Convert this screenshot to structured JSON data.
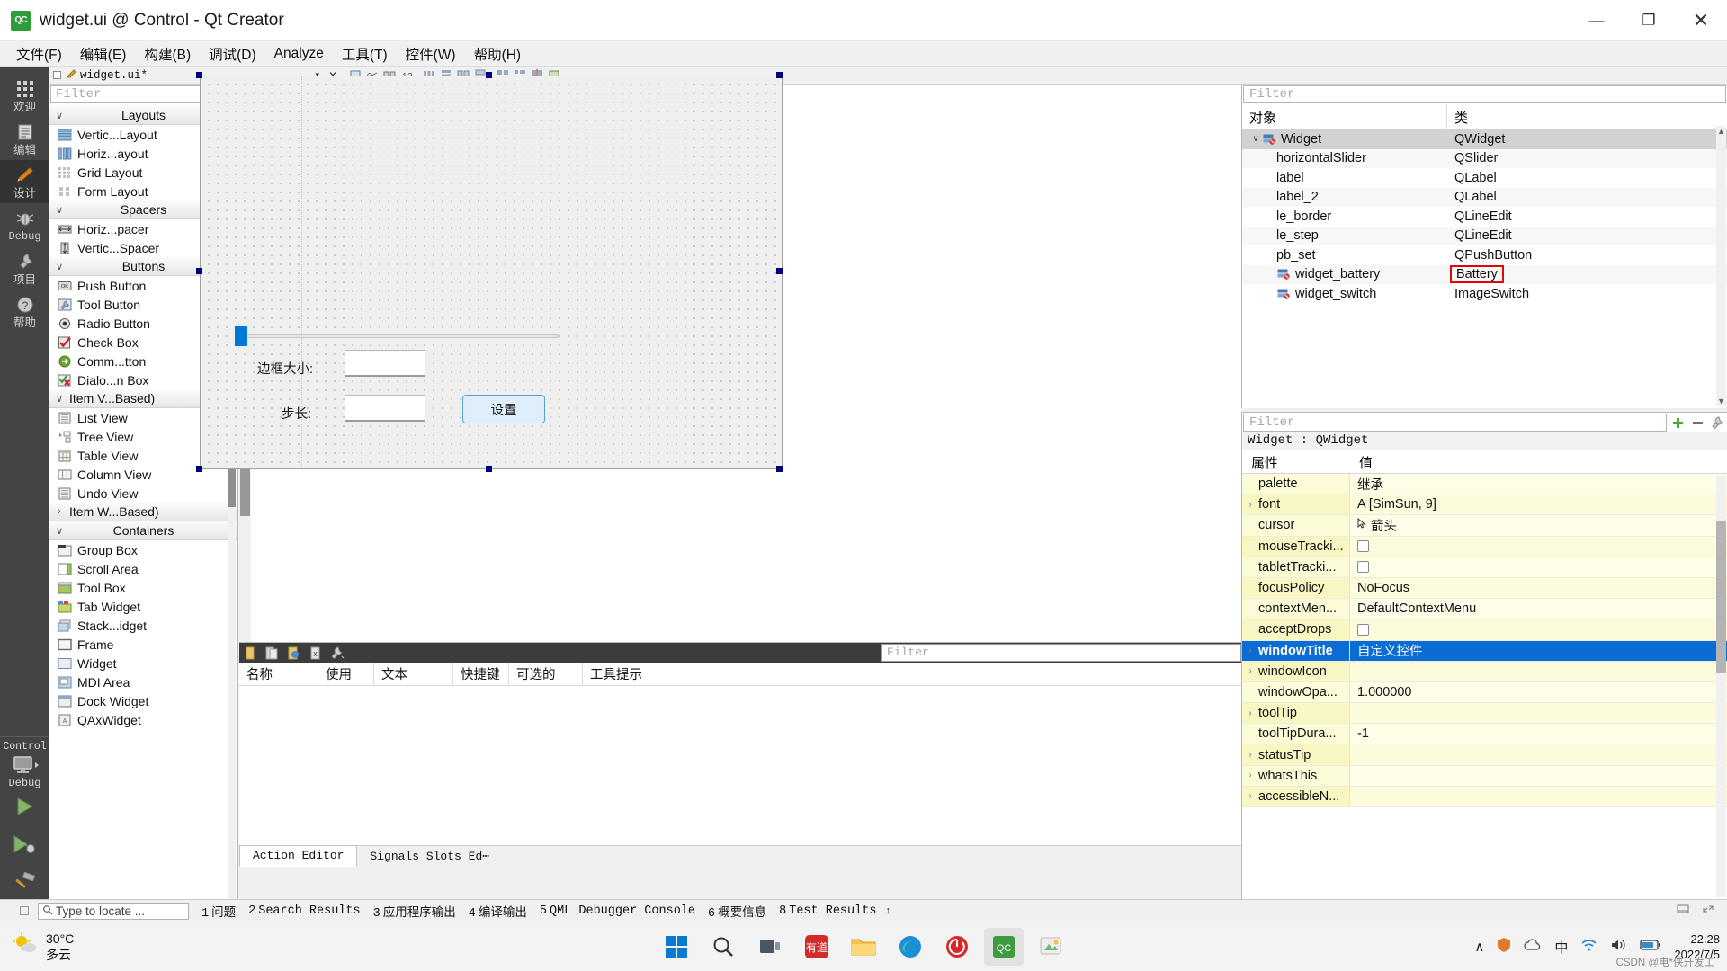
{
  "window": {
    "icon_label": "QC",
    "title": "widget.ui @ Control - Qt Creator",
    "minimize": "—",
    "maximize": "❐",
    "close": "✕"
  },
  "menubar": {
    "items": [
      "文件(F)",
      "编辑(E)",
      "构建(B)",
      "调试(D)",
      "Analyze",
      "工具(T)",
      "控件(W)",
      "帮助(H)"
    ]
  },
  "modebar": {
    "items": [
      {
        "label": "欢迎",
        "icon": "grid-icon"
      },
      {
        "label": "编辑",
        "icon": "document-icon"
      },
      {
        "label": "设计",
        "icon": "pencil-icon"
      },
      {
        "label": "Debug",
        "icon": "bug-icon"
      },
      {
        "label": "项目",
        "icon": "wrench-icon"
      },
      {
        "label": "帮助",
        "icon": "question-icon"
      }
    ],
    "active_index": 2,
    "kit_name": "Control",
    "kit_config": "Debug",
    "run_label": "run-icon",
    "debug_label": "debug-icon",
    "build_label": "build-icon"
  },
  "editor_toolbar": {
    "document_name": "widget.ui*",
    "close_label": "✕",
    "dropdown_caret": "▾"
  },
  "widget_box": {
    "filter_placeholder": "Filter",
    "groups": [
      {
        "title": "Layouts",
        "expanded": true,
        "items": [
          {
            "label": "Vertic...Layout",
            "icon": "vertical-layout-icon"
          },
          {
            "label": "Horiz...ayout",
            "icon": "horizontal-layout-icon"
          },
          {
            "label": "Grid Layout",
            "icon": "grid-layout-icon"
          },
          {
            "label": "Form Layout",
            "icon": "form-layout-icon"
          }
        ]
      },
      {
        "title": "Spacers",
        "expanded": true,
        "items": [
          {
            "label": "Horiz...pacer",
            "icon": "horizontal-spacer-icon"
          },
          {
            "label": "Vertic...Spacer",
            "icon": "vertical-spacer-icon"
          }
        ]
      },
      {
        "title": "Buttons",
        "expanded": true,
        "items": [
          {
            "label": "Push Button",
            "icon": "push-button-icon"
          },
          {
            "label": "Tool Button",
            "icon": "tool-button-icon"
          },
          {
            "label": "Radio Button",
            "icon": "radio-button-icon"
          },
          {
            "label": "Check Box",
            "icon": "check-box-icon"
          },
          {
            "label": "Comm...tton",
            "icon": "command-link-icon"
          },
          {
            "label": "Dialo...n Box",
            "icon": "dialog-button-box-icon"
          }
        ]
      },
      {
        "title": "Item V...Based)",
        "expanded": true,
        "left_aligned": true,
        "items": [
          {
            "label": "List View",
            "icon": "list-view-icon"
          },
          {
            "label": "Tree View",
            "icon": "tree-view-icon"
          },
          {
            "label": "Table View",
            "icon": "table-view-icon"
          },
          {
            "label": "Column View",
            "icon": "column-view-icon"
          },
          {
            "label": "Undo View",
            "icon": "undo-view-icon"
          }
        ]
      },
      {
        "title": "Item W...Based)",
        "expanded": false,
        "left_aligned": true,
        "items": []
      },
      {
        "title": "Containers",
        "expanded": true,
        "items": [
          {
            "label": "Group Box",
            "icon": "group-box-icon"
          },
          {
            "label": "Scroll Area",
            "icon": "scroll-area-icon"
          },
          {
            "label": "Tool Box",
            "icon": "tool-box-icon"
          },
          {
            "label": "Tab Widget",
            "icon": "tab-widget-icon"
          },
          {
            "label": "Stack...idget",
            "icon": "stacked-widget-icon"
          },
          {
            "label": "Frame",
            "icon": "frame-icon"
          },
          {
            "label": "Widget",
            "icon": "widget-icon"
          },
          {
            "label": "MDI Area",
            "icon": "mdi-area-icon"
          },
          {
            "label": "Dock Widget",
            "icon": "dock-widget-icon"
          },
          {
            "label": "QAxWidget",
            "icon": "qax-widget-icon"
          }
        ]
      }
    ]
  },
  "form": {
    "label_border": "边框大小:",
    "label_step": "步长:",
    "lineedit_border_value": "",
    "lineedit_step_value": "",
    "button_set": "设置"
  },
  "action_editor": {
    "filter_placeholder": "Filter",
    "columns": [
      "名称",
      "使用",
      "文本",
      "快捷键",
      "可选的",
      "工具提示"
    ],
    "tabs": [
      "Action Editor",
      "Signals  Slots Ed⋯"
    ],
    "active_tab": 0
  },
  "object_inspector": {
    "filter_placeholder": "Filter",
    "columns": [
      "对象",
      "类"
    ],
    "rows": [
      {
        "name": "Widget",
        "class": "QWidget",
        "indent": 0,
        "has_icon": true,
        "expandable": true,
        "selected": true
      },
      {
        "name": "horizontalSlider",
        "class": "QSlider",
        "indent": 1,
        "has_icon": false
      },
      {
        "name": "label",
        "class": "QLabel",
        "indent": 1,
        "has_icon": false
      },
      {
        "name": "label_2",
        "class": "QLabel",
        "indent": 1,
        "has_icon": false
      },
      {
        "name": "le_border",
        "class": "QLineEdit",
        "indent": 1,
        "has_icon": false
      },
      {
        "name": "le_step",
        "class": "QLineEdit",
        "indent": 1,
        "has_icon": false
      },
      {
        "name": "pb_set",
        "class": "QPushButton",
        "indent": 1,
        "has_icon": false
      },
      {
        "name": "widget_battery",
        "class": "Battery",
        "indent": 1,
        "has_icon": true,
        "highlight_class": true
      },
      {
        "name": "widget_switch",
        "class": "ImageSwitch",
        "indent": 1,
        "has_icon": true
      }
    ]
  },
  "property_editor": {
    "filter_placeholder": "Filter",
    "object_line": "Widget : QWidget",
    "columns": [
      "属性",
      "值"
    ],
    "add_icon": "plus-icon",
    "remove_icon": "minus-icon",
    "config_icon": "wrench-icon",
    "rows": [
      {
        "key": "palette",
        "value": "继承",
        "type": "text",
        "expandable": false
      },
      {
        "key": "font",
        "value": "A  [SimSun, 9]",
        "type": "font",
        "expandable": true
      },
      {
        "key": "cursor",
        "value": "箭头",
        "type": "cursor",
        "expandable": false
      },
      {
        "key": "mouseTracki...",
        "value": "",
        "type": "checkbox",
        "expandable": false
      },
      {
        "key": "tabletTracki...",
        "value": "",
        "type": "checkbox",
        "expandable": false
      },
      {
        "key": "focusPolicy",
        "value": "NoFocus",
        "type": "text",
        "expandable": false
      },
      {
        "key": "contextMen...",
        "value": "DefaultContextMenu",
        "type": "text",
        "expandable": false
      },
      {
        "key": "acceptDrops",
        "value": "",
        "type": "checkbox",
        "expandable": false
      },
      {
        "key": "windowTitle",
        "value": "自定义控件",
        "type": "text",
        "expandable": true,
        "selected": true
      },
      {
        "key": "windowIcon",
        "value": "",
        "type": "text",
        "expandable": true
      },
      {
        "key": "windowOpa...",
        "value": "1.000000",
        "type": "text",
        "expandable": false
      },
      {
        "key": "toolTip",
        "value": "",
        "type": "text",
        "expandable": true
      },
      {
        "key": "toolTipDura...",
        "value": "-1",
        "type": "text",
        "expandable": false
      },
      {
        "key": "statusTip",
        "value": "",
        "type": "text",
        "expandable": true
      },
      {
        "key": "whatsThis",
        "value": "",
        "type": "text",
        "expandable": true
      },
      {
        "key": "accessibleN...",
        "value": "",
        "type": "text",
        "expandable": true
      }
    ]
  },
  "statusbar": {
    "locate_placeholder": "Type to locate ...",
    "search_icon": "search-icon",
    "panes": [
      {
        "num": "1",
        "label": "问题"
      },
      {
        "num": "2",
        "label": "Search Results"
      },
      {
        "num": "3",
        "label": "应用程序输出"
      },
      {
        "num": "4",
        "label": "编译输出"
      },
      {
        "num": "5",
        "label": "QML Debugger Console"
      },
      {
        "num": "6",
        "label": "概要信息"
      },
      {
        "num": "8",
        "label": "Test Results"
      }
    ],
    "caret": "↕"
  },
  "taskbar": {
    "weather_temp": "30°C",
    "weather_desc": "多云",
    "weather_icon": "sun-cloud-icon",
    "apps": [
      {
        "name": "start-button",
        "icon": "windows-icon"
      },
      {
        "name": "search-button",
        "icon": "search-icon"
      },
      {
        "name": "task-view-button",
        "icon": "taskview-icon"
      },
      {
        "name": "youdao-app",
        "icon": "youdao-icon"
      },
      {
        "name": "file-explorer-app",
        "icon": "folder-icon"
      },
      {
        "name": "edge-browser-app",
        "icon": "edge-icon"
      },
      {
        "name": "wegame-app",
        "icon": "wegame-icon"
      },
      {
        "name": "qt-creator-app",
        "icon": "qtcreator-icon"
      },
      {
        "name": "paint-app",
        "icon": "paint-icon"
      }
    ],
    "active_app_index": 7,
    "tray": {
      "chevron": "∧",
      "security_icon": "shield-icon",
      "cloud_icon": "cloud-icon",
      "ime": "中",
      "wifi_icon": "wifi-icon",
      "volume_icon": "volume-icon",
      "battery_icon": "battery-icon"
    },
    "clock_time": "22:28",
    "clock_date": "2022/7/5",
    "watermark": "CSDN @电*侠开发工"
  }
}
